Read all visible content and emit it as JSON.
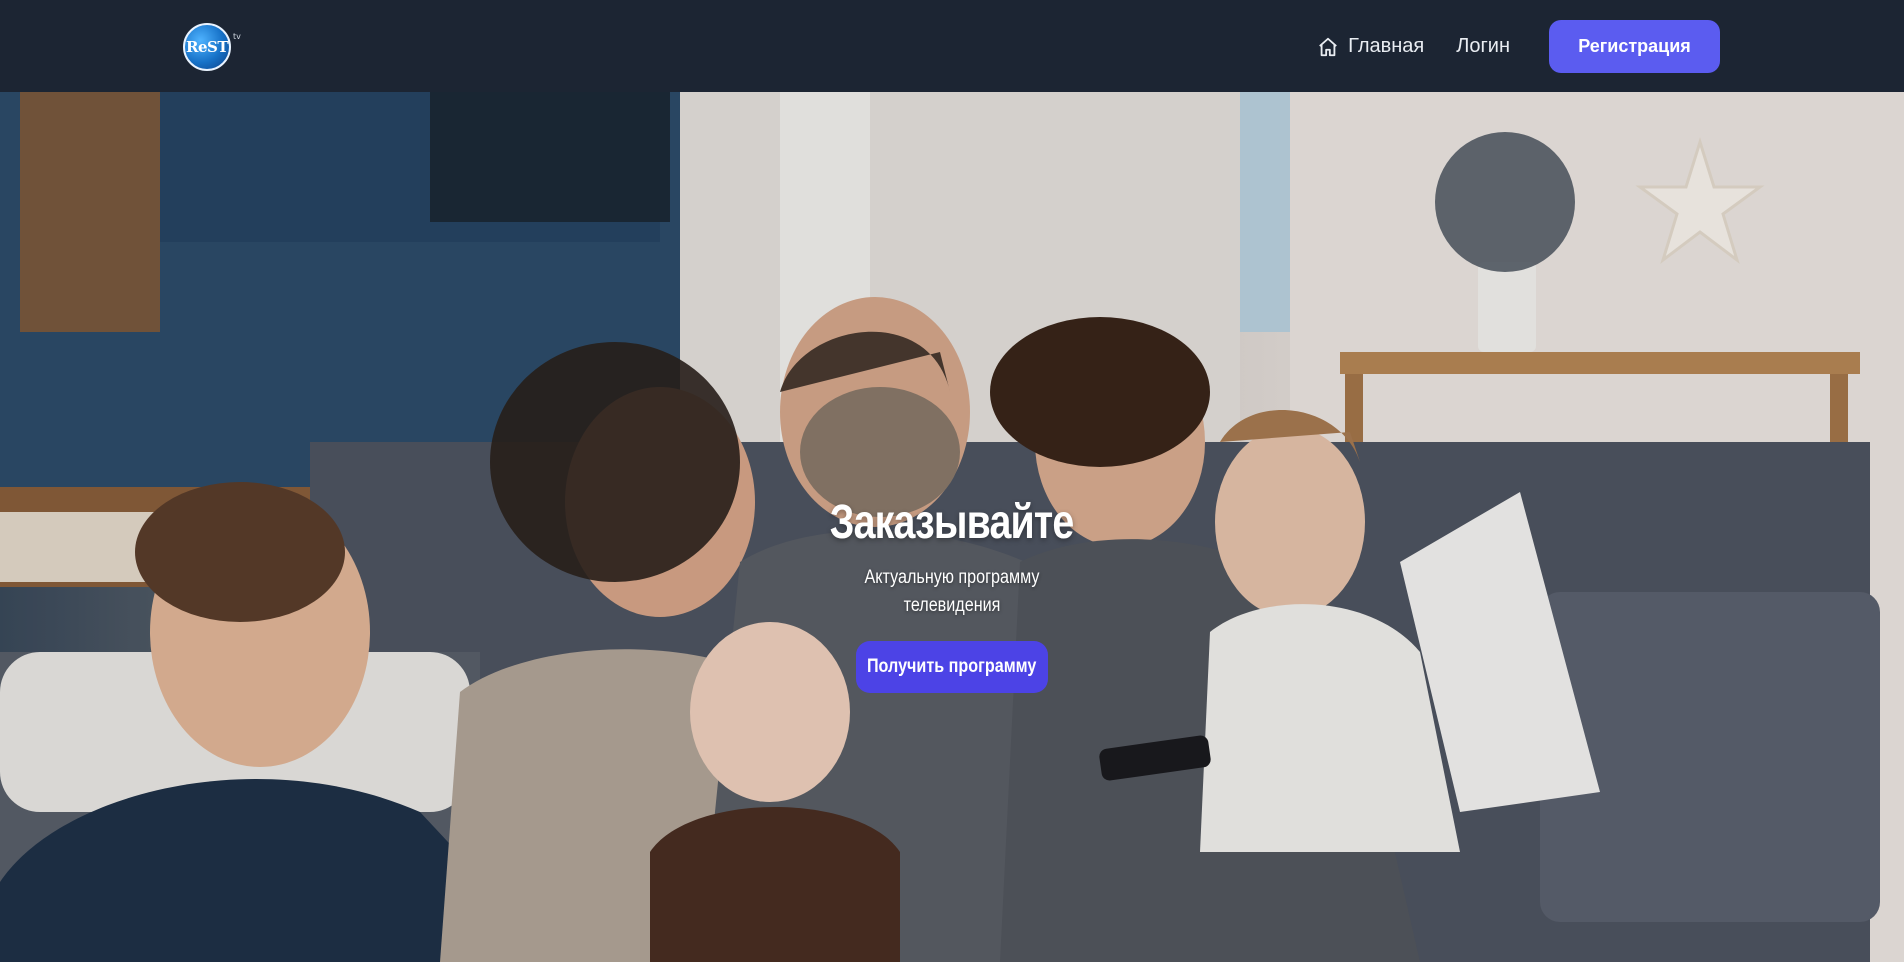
{
  "header": {
    "logo_text": "ReST",
    "logo_suffix": "tv",
    "nav": {
      "home_label": "Главная",
      "login_label": "Логин",
      "register_label": "Регистрация"
    }
  },
  "hero": {
    "title": "Заказывайте",
    "subtitle": "Актуальную программу телевидения",
    "cta_label": "Получить программу"
  },
  "colors": {
    "header_bg": "#1c2533",
    "accent": "#5b5cf0",
    "cta": "#4c43e6",
    "text_light": "#e9edf2"
  },
  "icons": {
    "home": "home-icon",
    "logo": "rest-tv-logo"
  }
}
